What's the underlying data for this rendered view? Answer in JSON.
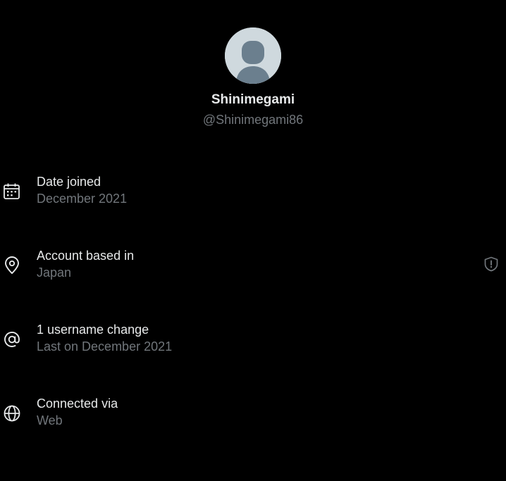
{
  "profile": {
    "display_name": "Shinimegami",
    "handle": "@Shinimegami86"
  },
  "details": [
    {
      "icon": "calendar-icon",
      "label": "Date joined",
      "value": "December 2021"
    },
    {
      "icon": "location-pin-icon",
      "label": "Account based in",
      "value": "Japan"
    },
    {
      "icon": "at-sign-icon",
      "label": "1 username change",
      "value": "Last on December 2021"
    },
    {
      "icon": "globe-icon",
      "label": "Connected via",
      "value": "Web"
    }
  ],
  "colors": {
    "background": "#000000",
    "primary_text": "#e7e9ea",
    "secondary_text": "#71767b",
    "avatar_bg": "#cfd9de",
    "avatar_silhouette": "#6b7f8e"
  }
}
